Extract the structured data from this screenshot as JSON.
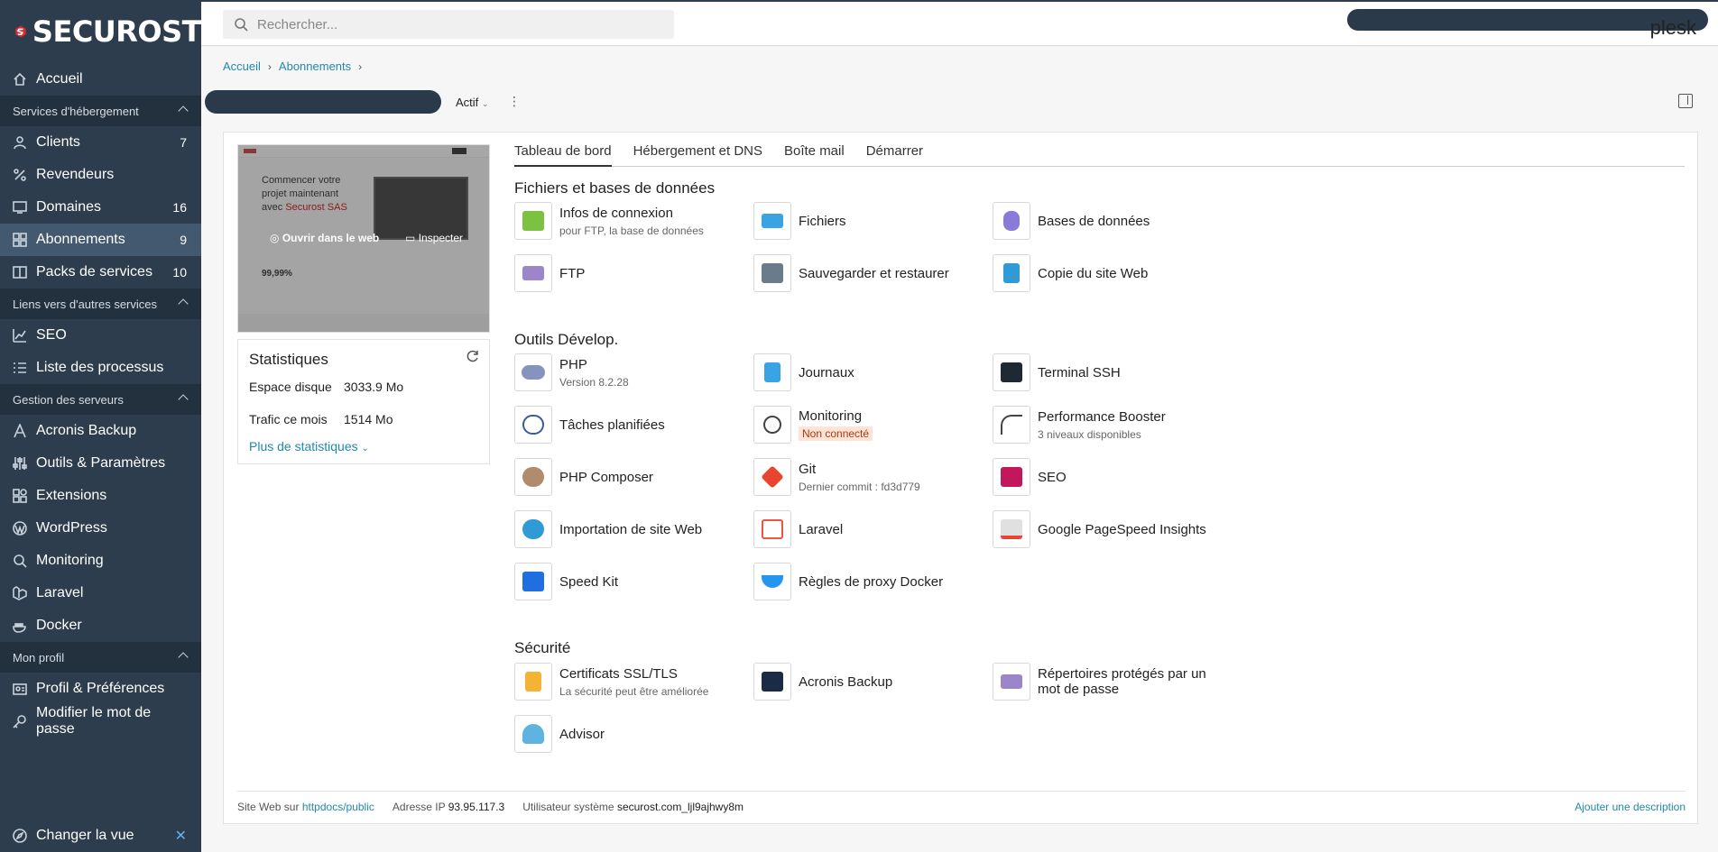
{
  "brand": {
    "name": "SECUROST",
    "color": "#e1292b"
  },
  "sidebar": {
    "items": [
      {
        "label": "Accueil",
        "icon": "home-icon"
      },
      {
        "section": "Services d'hébergement"
      },
      {
        "label": "Clients",
        "icon": "user-icon",
        "count": "7"
      },
      {
        "label": "Revendeurs",
        "icon": "percent-icon"
      },
      {
        "label": "Domaines",
        "icon": "monitor-icon",
        "count": "16"
      },
      {
        "label": "Abonnements",
        "icon": "grid-icon",
        "count": "9",
        "active": true
      },
      {
        "label": "Packs de services",
        "icon": "book-icon",
        "count": "10"
      },
      {
        "section": "Liens vers d'autres services"
      },
      {
        "label": "SEO",
        "icon": "chart-icon"
      },
      {
        "label": "Liste des processus",
        "icon": "list-icon"
      },
      {
        "section": "Gestion des serveurs"
      },
      {
        "label": "Acronis Backup",
        "icon": "acronis-icon"
      },
      {
        "label": "Outils & Paramètres",
        "icon": "sliders-icon"
      },
      {
        "label": "Extensions",
        "icon": "extensions-icon"
      },
      {
        "label": "WordPress",
        "icon": "wordpress-icon"
      },
      {
        "label": "Monitoring",
        "icon": "monitoring-icon"
      },
      {
        "label": "Laravel",
        "icon": "laravel-icon"
      },
      {
        "label": "Docker",
        "icon": "docker-icon"
      },
      {
        "section": "Mon profil"
      },
      {
        "label": "Profil & Préférences",
        "icon": "profile-icon"
      },
      {
        "label": "Modifier le mot de passe",
        "icon": "key-icon"
      }
    ],
    "footer": "Changer la vue"
  },
  "topbar": {
    "search_placeholder": "Rechercher...",
    "user": "plesk"
  },
  "breadcrumb": [
    "Accueil",
    "Abonnements"
  ],
  "subscription": {
    "status": "Actif"
  },
  "preview": {
    "headline_1": "Commencer votre",
    "headline_2": "projet maintenant",
    "headline_3": "avec",
    "headline_brand": "Securost SAS",
    "stat": "99,99%",
    "open_label": "Ouvrir dans le web",
    "inspect_label": "Inspecter"
  },
  "stats": {
    "title": "Statistiques",
    "disk_label": "Espace disque",
    "disk_value": "3033.9 Mo",
    "traffic_label": "Trafic ce mois",
    "traffic_value": "1514 Mo",
    "more": "Plus de statistiques"
  },
  "tabs": [
    "Tableau de bord",
    "Hébergement et DNS",
    "Boîte mail",
    "Démarrer"
  ],
  "sections": {
    "files": "Fichiers et bases de données",
    "dev": "Outils Dévelop.",
    "security": "Sécurité"
  },
  "tools": {
    "infos": {
      "label": "Infos de connexion",
      "sub": "pour FTP, la base de données"
    },
    "fichiers": {
      "label": "Fichiers"
    },
    "bdd": {
      "label": "Bases de données"
    },
    "ftp": {
      "label": "FTP"
    },
    "backup": {
      "label": "Sauvegarder et restaurer"
    },
    "copie": {
      "label": "Copie du site Web"
    },
    "php": {
      "label": "PHP",
      "sub": "Version 8.2.28"
    },
    "journaux": {
      "label": "Journaux"
    },
    "ssh": {
      "label": "Terminal SSH"
    },
    "taches": {
      "label": "Tâches planifiées"
    },
    "monitoring": {
      "label": "Monitoring",
      "badge": "Non connecté"
    },
    "perf": {
      "label": "Performance Booster",
      "sub": "3 niveaux disponibles"
    },
    "composer": {
      "label": "PHP Composer"
    },
    "git": {
      "label": "Git",
      "sub": "Dernier commit : fd3d779"
    },
    "seo": {
      "label": "SEO"
    },
    "import": {
      "label": "Importation de site Web"
    },
    "laravel": {
      "label": "Laravel"
    },
    "pagespeed": {
      "label": "Google PageSpeed Insights"
    },
    "speedkit": {
      "label": "Speed Kit"
    },
    "docker": {
      "label": "Règles de proxy Docker"
    },
    "ssl": {
      "label": "Certificats SSL/TLS",
      "sub": "La sécurité peut être améliorée"
    },
    "acronis": {
      "label": "Acronis Backup"
    },
    "rep": {
      "label": "Répertoires protégés par un",
      "label2": "mot de passe"
    },
    "advisor": {
      "label": "Advisor"
    }
  },
  "footer": {
    "site_label": "Site Web sur",
    "site_path": "httpdocs/public",
    "ip_label": "Adresse IP",
    "ip": "93.95.117.3",
    "user_label": "Utilisateur système",
    "user": "securost.com_ljl9ajhwy8m",
    "add_desc": "Ajouter une description"
  }
}
